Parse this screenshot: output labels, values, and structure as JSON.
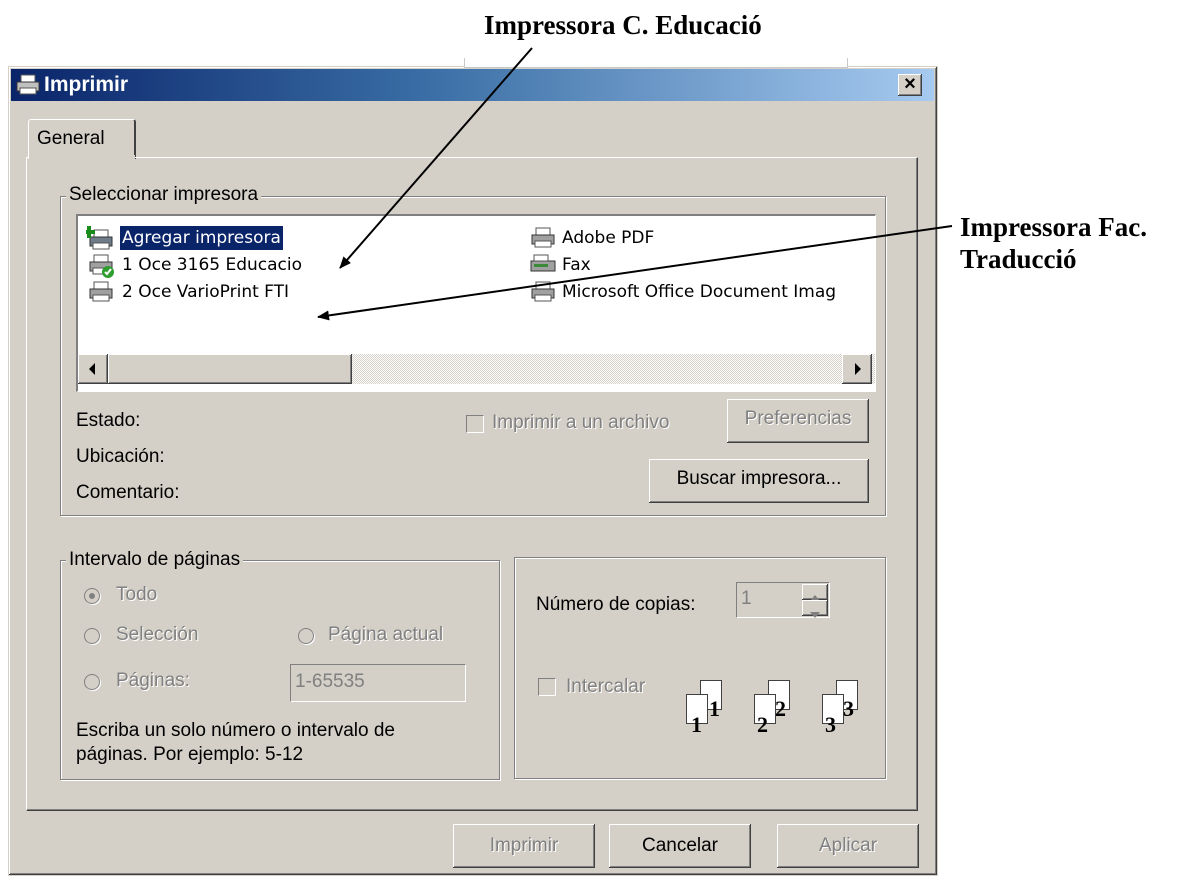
{
  "annotations": {
    "top": "Impressora C. Educació",
    "right_line1": "Impressora Fac.",
    "right_line2": "Traducció"
  },
  "window": {
    "title": "Imprimir",
    "close_label": "×"
  },
  "tabs": [
    {
      "label": "General"
    }
  ],
  "select_printer": {
    "legend": "Seleccionar impresora",
    "items": [
      {
        "label": "Agregar impresora",
        "icon": "add-printer-icon",
        "selected": true
      },
      {
        "label": "1 Oce 3165 Educacio",
        "icon": "default-printer-icon"
      },
      {
        "label": "2 Oce VarioPrint FTI",
        "icon": "printer-icon"
      },
      {
        "label": "Adobe PDF",
        "icon": "printer-icon"
      },
      {
        "label": "Fax",
        "icon": "fax-icon"
      },
      {
        "label": "Microsoft Office Document Imag",
        "icon": "printer-icon"
      }
    ],
    "status_label": "Estado:",
    "location_label": "Ubicación:",
    "comment_label": "Comentario:",
    "print_to_file_label": "Imprimir a un archivo",
    "preferences_label": "Preferencias",
    "find_printer_label": "Buscar impresora..."
  },
  "page_range": {
    "legend": "Intervalo de páginas",
    "all_label": "Todo",
    "selection_label": "Selección",
    "current_page_label": "Página actual",
    "pages_label": "Páginas:",
    "pages_value": "1-65535",
    "hint_line1": "Escriba un solo número o intervalo de",
    "hint_line2": "páginas. Por ejemplo: 5-12"
  },
  "copies": {
    "label": "Número de copias:",
    "value": "1",
    "collate_label": "Intercalar",
    "collate_icons": [
      {
        "back": "1",
        "front": "1"
      },
      {
        "back": "2",
        "front": "2"
      },
      {
        "back": "3",
        "front": "3"
      }
    ]
  },
  "buttons": {
    "print": "Imprimir",
    "cancel": "Cancelar",
    "apply": "Aplicar"
  }
}
